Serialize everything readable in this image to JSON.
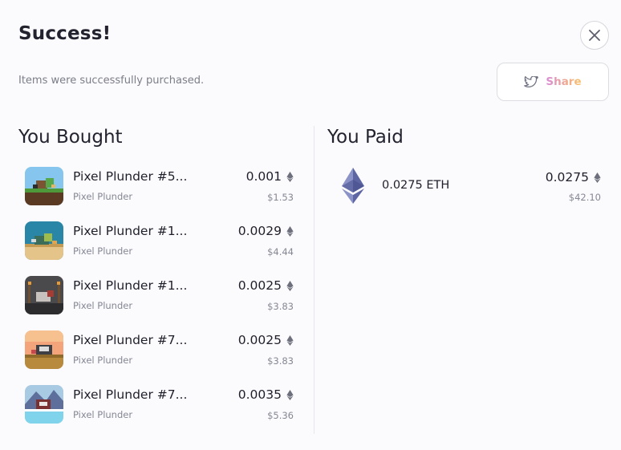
{
  "header": {
    "title": "Success!",
    "subtitle": "Items were successfully purchased.",
    "share_label": "Share"
  },
  "bought": {
    "heading": "You Bought",
    "items": [
      {
        "name": "Pixel Plunder #5...",
        "collection": "Pixel Plunder",
        "price": "0.001",
        "usd": "$1.53"
      },
      {
        "name": "Pixel Plunder #1...",
        "collection": "Pixel Plunder",
        "price": "0.0029",
        "usd": "$4.44"
      },
      {
        "name": "Pixel Plunder #1...",
        "collection": "Pixel Plunder",
        "price": "0.0025",
        "usd": "$3.83"
      },
      {
        "name": "Pixel Plunder #7...",
        "collection": "Pixel Plunder",
        "price": "0.0025",
        "usd": "$3.83"
      },
      {
        "name": "Pixel Plunder #7...",
        "collection": "Pixel Plunder",
        "price": "0.0035",
        "usd": "$5.36"
      }
    ]
  },
  "paid": {
    "heading": "You Paid",
    "amount_label": "0.0275 ETH",
    "price": "0.0275",
    "usd": "$42.10"
  },
  "icons": {
    "close": "close-icon",
    "share": "twitter-icon",
    "currency": "ethereum-icon"
  },
  "colors": {
    "share_gradient": [
      "#d88bd9",
      "#f1a98b",
      "#f5c36b"
    ],
    "eth_logo": "#6b74b4"
  }
}
